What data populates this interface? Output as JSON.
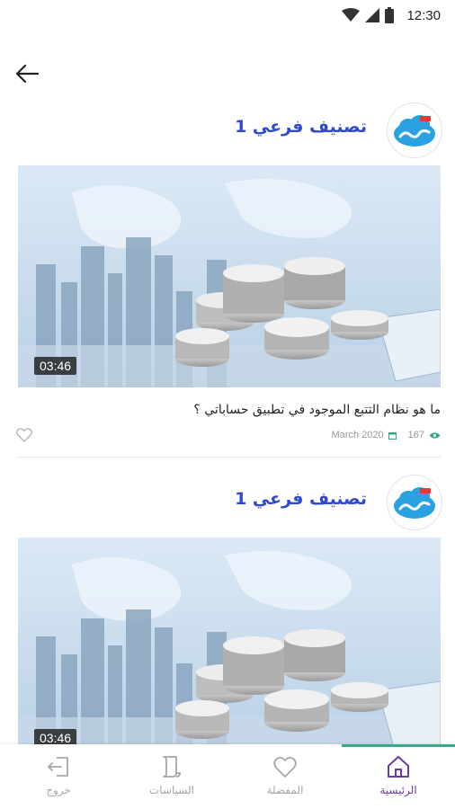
{
  "status_bar": {
    "time": "12:30"
  },
  "app_bar": {
    "back_icon": "arrow-left-icon"
  },
  "cards": [
    {
      "channel_title": "تصنيف فرعي 1",
      "duration": "03:46",
      "video_title": "ما هو نظام التتبع الموجود في تطبيق حساباتي ؟",
      "date": "March 2020",
      "views": "167"
    },
    {
      "channel_title": "تصنيف فرعي 1",
      "duration": "03:46"
    }
  ],
  "bottom_nav": {
    "items": [
      {
        "label": "الرئيسية",
        "icon": "home-icon",
        "active": true
      },
      {
        "label": "المفضلة",
        "icon": "heart-icon",
        "active": false
      },
      {
        "label": "السياسات",
        "icon": "document-icon",
        "active": false
      },
      {
        "label": "خروج",
        "icon": "logout-icon",
        "active": false
      }
    ]
  },
  "colors": {
    "accent": "#2f49d1",
    "nav_active": "#6a3aa8",
    "nav_indicator": "#3aa88a",
    "views_icon": "#2eaa7a"
  }
}
